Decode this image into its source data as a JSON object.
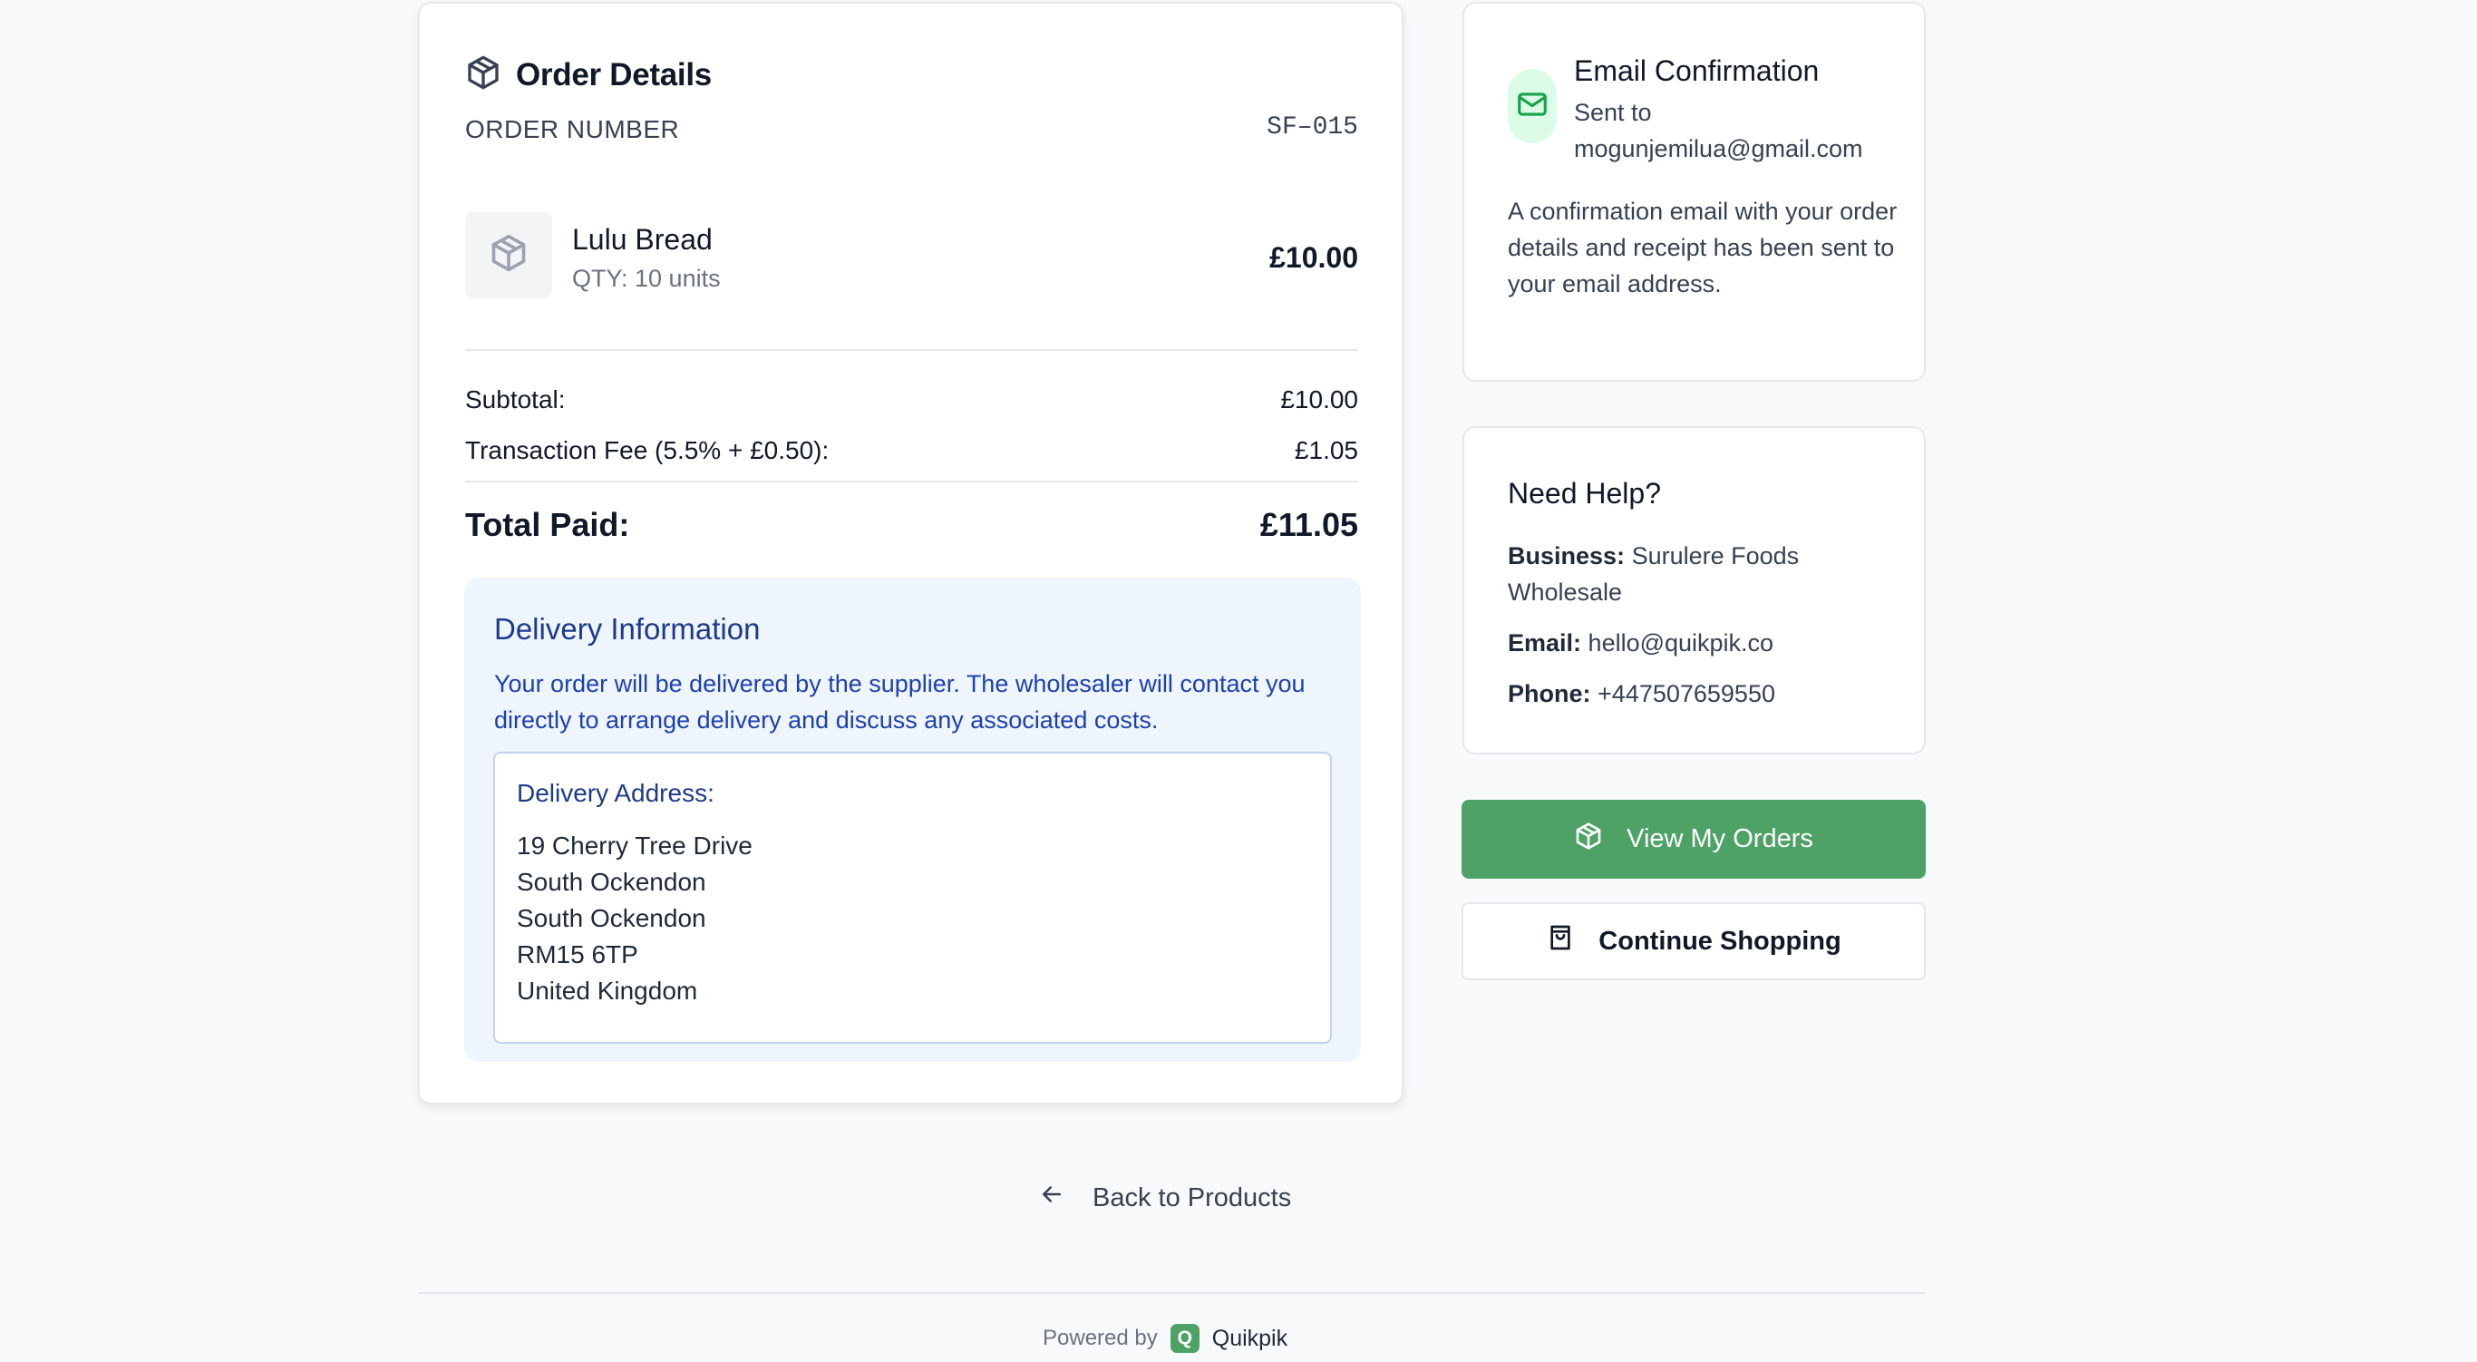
{
  "order": {
    "title": "Order Details",
    "number_label": "ORDER NUMBER",
    "number_value": "SF–015",
    "product": {
      "name": "Lulu Bread",
      "qty": "QTY: 10 units",
      "price": "£10.00"
    },
    "subtotal_label": "Subtotal:",
    "subtotal_value": "£10.00",
    "fee_label": "Transaction Fee (5.5% + £0.50):",
    "fee_value": "£1.05",
    "total_label": "Total Paid:",
    "total_value": "£11.05"
  },
  "delivery": {
    "title": "Delivery Information",
    "text": "Your order will be delivered by the supplier. The wholesaler will contact you directly to arrange delivery and discuss any associated costs.",
    "address_label": "Delivery Address:",
    "address_lines": [
      "19 Cherry Tree Drive",
      "South Ockendon",
      "South Ockendon",
      "RM15 6TP",
      "United Kingdom"
    ]
  },
  "email": {
    "title": "Email Confirmation",
    "sent_prefix": "Sent to",
    "address": "mogunjemilua@gmail.com",
    "description": "A confirmation email with your order details and receipt has been sent to your email address."
  },
  "help": {
    "title": "Need Help?",
    "business_label": "Business:",
    "business_value": "Surulere Foods Wholesale",
    "email_label": "Email:",
    "email_value": "hello@quikpik.co",
    "phone_label": "Phone:",
    "phone_value": "+447507659550"
  },
  "actions": {
    "view_orders": "View My Orders",
    "continue_shopping": "Continue Shopping",
    "back": "Back to Products"
  },
  "footer": {
    "powered_by": "Powered by",
    "logo_letter": "Q",
    "brand": "Quikpik"
  },
  "colors": {
    "accent": "#4ea266",
    "delivery_bg": "#eef5fd",
    "delivery_text": "#1e40af"
  },
  "icons": {
    "title": "package-icon",
    "product": "package-icon",
    "email": "mail-icon",
    "orders_button": "package-icon",
    "shop_button": "shopping-bag-icon",
    "back": "arrow-left-icon"
  }
}
